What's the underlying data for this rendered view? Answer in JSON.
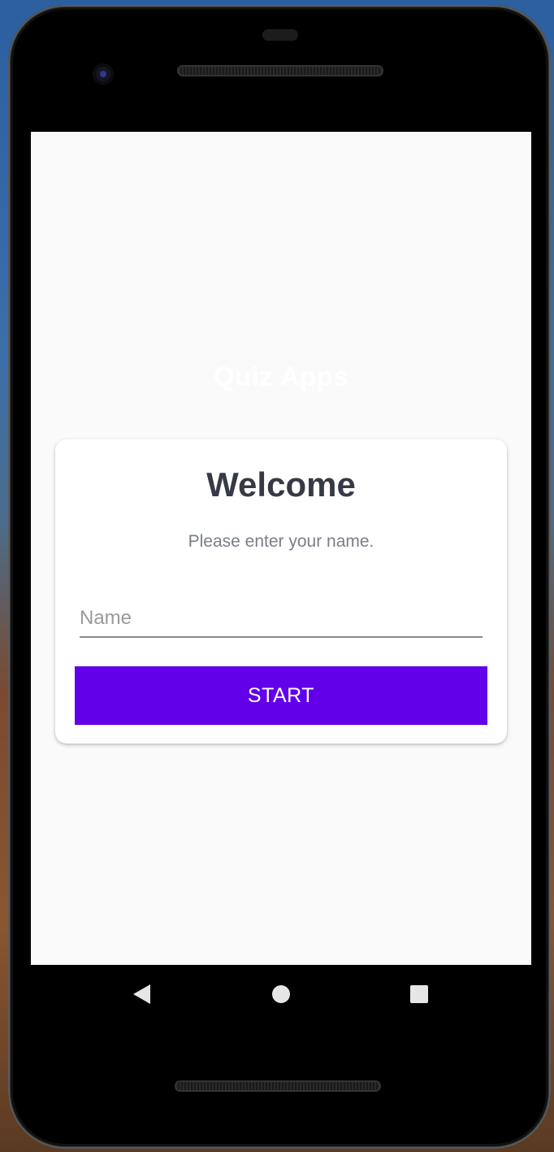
{
  "app": {
    "title": "Quiz Apps"
  },
  "card": {
    "heading": "Welcome",
    "subtitle": "Please enter your name.",
    "name_input": {
      "value": "",
      "placeholder": "Name"
    },
    "start_label": "START"
  },
  "navbar": {
    "back_icon": "back-triangle-icon",
    "home_icon": "home-circle-icon",
    "recents_icon": "recents-square-icon"
  },
  "colors": {
    "accent": "#6200ea",
    "screen_bg": "#fafafa",
    "heading": "#363a45",
    "subtitle": "#7a7e88"
  }
}
